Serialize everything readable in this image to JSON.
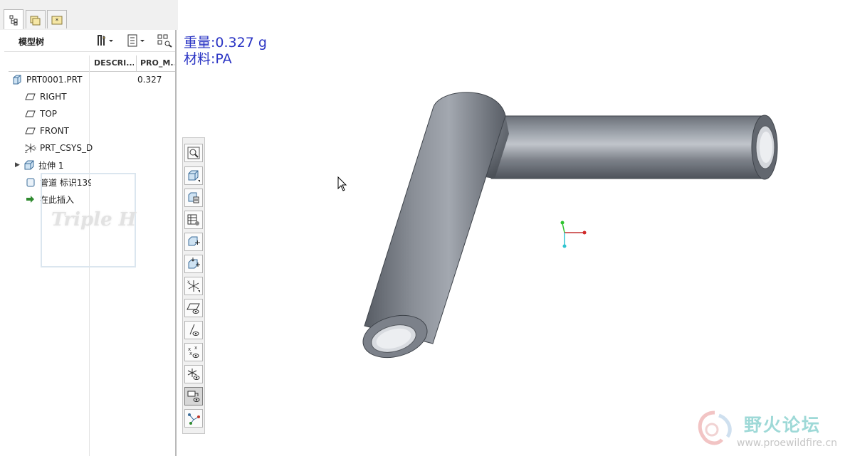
{
  "navigator": {
    "tabs": [
      {
        "icon": "model-tree-icon"
      },
      {
        "icon": "folder-browser-icon"
      },
      {
        "icon": "favorites-icon"
      }
    ],
    "tree_title": "模型树",
    "columns": [
      "DESCRI...",
      "PRO_M..."
    ],
    "items": [
      {
        "label": "PRT0001.PRT",
        "value": "0.327",
        "icon": "part-icon"
      },
      {
        "label": "RIGHT",
        "icon": "datum-plane-icon"
      },
      {
        "label": "TOP",
        "icon": "datum-plane-icon"
      },
      {
        "label": "FRONT",
        "icon": "datum-plane-icon"
      },
      {
        "label": "PRT_CSYS_D",
        "icon": "csys-icon"
      },
      {
        "label": "拉伸 1",
        "icon": "extrude-icon",
        "expandable": true
      },
      {
        "label": "管道 标识139",
        "icon": "pipe-icon"
      },
      {
        "label": "在此插入",
        "icon": "insert-arrow-icon"
      }
    ],
    "watermark": "Triple H"
  },
  "graphics": {
    "info_weight": "重量:0.327 g",
    "info_material": "材料:PA"
  },
  "vtoolbar": [
    {
      "icon": "zoom-icon"
    },
    {
      "icon": "saved-view-icon"
    },
    {
      "icon": "view-manager-icon"
    },
    {
      "icon": "appearance-icon"
    },
    {
      "icon": "spin-center-icon"
    },
    {
      "icon": "orient-mode-icon"
    },
    {
      "icon": "csys-display-icon"
    },
    {
      "icon": "datum-plane-display-icon"
    },
    {
      "icon": "datum-axis-display-icon"
    },
    {
      "icon": "datum-point-display-icon"
    },
    {
      "icon": "csys-visibility-icon"
    },
    {
      "icon": "annotation-display-icon",
      "pressed": true
    },
    {
      "icon": "network-display-icon"
    }
  ],
  "logo": {
    "name": "野火论坛",
    "url": "www.proewildfire.cn"
  },
  "colors": {
    "info_text": "#2a34c4",
    "model_body": "#7c818a",
    "background": "#ffffff"
  }
}
